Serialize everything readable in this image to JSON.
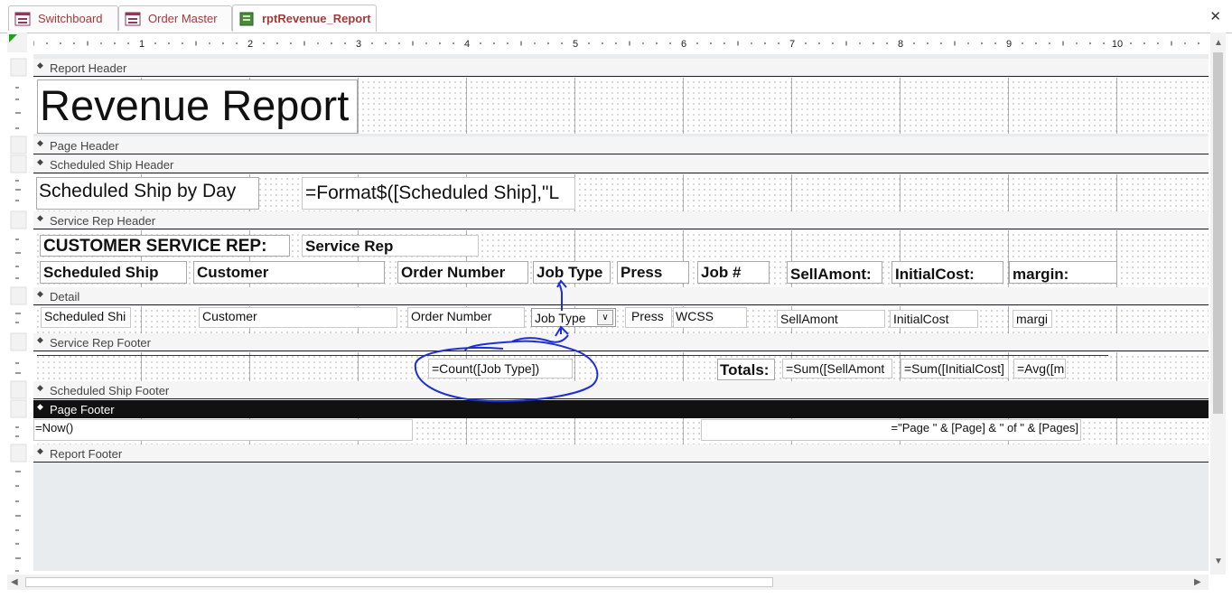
{
  "tabs": [
    {
      "label": "Switchboard"
    },
    {
      "label": "Order Master"
    },
    {
      "label": "rptRevenue_Report"
    }
  ],
  "close_glyph": "✕",
  "ruler": {
    "inches": [
      "1",
      "2",
      "3",
      "4",
      "5",
      "6",
      "7",
      "8",
      "9",
      "10"
    ]
  },
  "sections": {
    "report_header": "Report Header",
    "page_header": "Page Header",
    "scheduled_ship_header": "Scheduled Ship Header",
    "service_rep_header": "Service Rep Header",
    "detail": "Detail",
    "service_rep_footer": "Service Rep Footer",
    "scheduled_ship_footer": "Scheduled Ship Footer",
    "page_footer": "Page Footer",
    "report_footer": "Report Footer"
  },
  "report_header": {
    "title": "Revenue Report"
  },
  "scheduled_ship_header": {
    "label": "Scheduled Ship by Day",
    "expr": "=Format$([Scheduled Ship],\"L"
  },
  "service_rep_header": {
    "rep_label": "CUSTOMER SERVICE REP:",
    "rep_field": "Service Rep",
    "columns": {
      "scheduled_ship": "Scheduled Ship",
      "customer": "Customer",
      "order_number": "Order Number",
      "job_type": "Job Type",
      "press": "Press",
      "job_no": "Job #",
      "sell_amount": "SellAmont:",
      "initial_cost": "InitialCost:",
      "margin": "margin:"
    }
  },
  "detail": {
    "scheduled_ship": "Scheduled Shi",
    "customer": "Customer",
    "order_number": "Order Number",
    "job_type": "Job Type",
    "press": "Press",
    "wcss": "WCSS",
    "sell_amount": "SellAmont",
    "initial_cost": "InitialCost",
    "margin": "margi"
  },
  "service_rep_footer": {
    "count_expr": "=Count([Job Type])",
    "totals_label": "Totals:",
    "sum_sell": "=Sum([SellAmont",
    "sum_cost": "=Sum([InitialCost]",
    "avg_margin": "=Avg([m"
  },
  "page_footer": {
    "now_expr": "=Now()",
    "page_expr": "=\"Page \" & [Page] & \" of \" & [Pages]"
  },
  "colors": {
    "tab_text": "#a33a3a",
    "annotation_ink": "#1f2fd6",
    "grid_line": "#b0b0b0"
  },
  "icons": [
    "report-icon",
    "form-icon",
    "dropdown-arrow-icon",
    "section-arrow-icon"
  ]
}
